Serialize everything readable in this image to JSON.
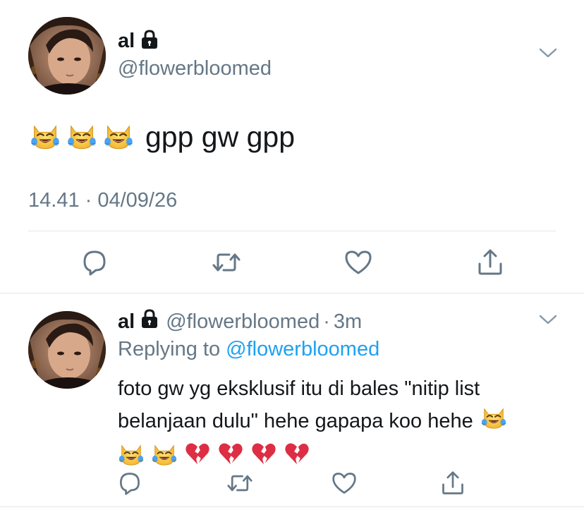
{
  "main_tweet": {
    "display_name": "al",
    "handle": "@flowerbloomed",
    "text": "gpp gw gpp",
    "emoji_prefix": [
      "joy-cat-emoji",
      "joy-cat-emoji",
      "joy-cat-emoji"
    ],
    "timestamp": "14.41 · 04/09/26",
    "locked": true
  },
  "reply_tweet": {
    "display_name": "al",
    "handle": "@flowerbloomed",
    "separator": "·",
    "time_ago": "3m",
    "replying_to_label": "Replying to",
    "replying_to_handle": "@flowerbloomed",
    "text_line_1": "foto gw yg eksklusif itu di bales \"nitip list",
    "text_line_2": "belanjaan dulu\" hehe gapapa koo hehe",
    "trailing_emojis": [
      "joy-cat-emoji",
      "joy-cat-emoji",
      "joy-cat-emoji",
      "broken-heart-emoji",
      "broken-heart-emoji",
      "broken-heart-emoji",
      "broken-heart-emoji"
    ],
    "locked": true
  },
  "icons": {
    "reply": "reply-icon",
    "retweet": "retweet-icon",
    "like": "heart-icon",
    "share": "share-icon",
    "more": "chevron-down-icon",
    "lock": "lock-icon"
  },
  "colors": {
    "text_primary": "#14171a",
    "text_secondary": "#657786",
    "link": "#1da1f2",
    "divider": "#e1e8ed",
    "icon": "#657786"
  }
}
